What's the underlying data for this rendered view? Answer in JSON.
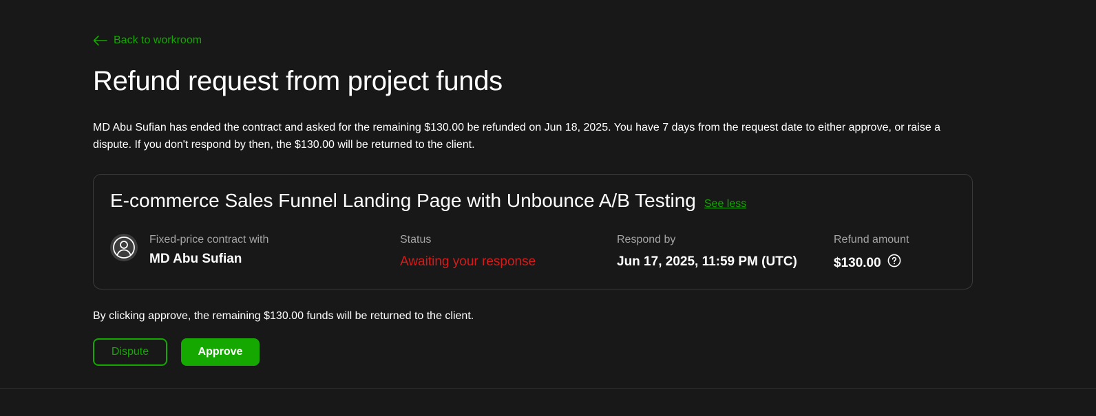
{
  "nav": {
    "back_label": "Back to workroom"
  },
  "page": {
    "title": "Refund request from project funds",
    "description": "MD Abu Sufian has ended the contract and asked for the remaining $130.00 be refunded on Jun 18, 2025. You have 7 days from the request date to either approve, or raise a dispute. If you don't respond by then, the $130.00 will be returned to the client."
  },
  "card": {
    "title": "E-commerce Sales Funnel Landing Page with Unbounce A/B Testing",
    "see_less_label": "See less",
    "contract": {
      "label": "Fixed-price contract with",
      "name": "MD Abu Sufian",
      "avatar_icon": "user-avatar-icon"
    },
    "status": {
      "label": "Status",
      "value": "Awaiting your response",
      "color": "#d71b1b"
    },
    "respond_by": {
      "label": "Respond by",
      "value": "Jun 17, 2025, 11:59 PM (UTC)"
    },
    "refund": {
      "label": "Refund amount",
      "value": "$130.00",
      "help_icon": "question-circle-icon"
    }
  },
  "footer": {
    "note": "By clicking approve, the remaining $130.00 funds will be returned to the client.",
    "dispute_label": "Dispute",
    "approve_label": "Approve"
  },
  "colors": {
    "background": "#181818",
    "accent": "#14a800",
    "danger": "#d71b1b",
    "border": "#3a3a3a",
    "muted_text": "#a5a5a5"
  }
}
